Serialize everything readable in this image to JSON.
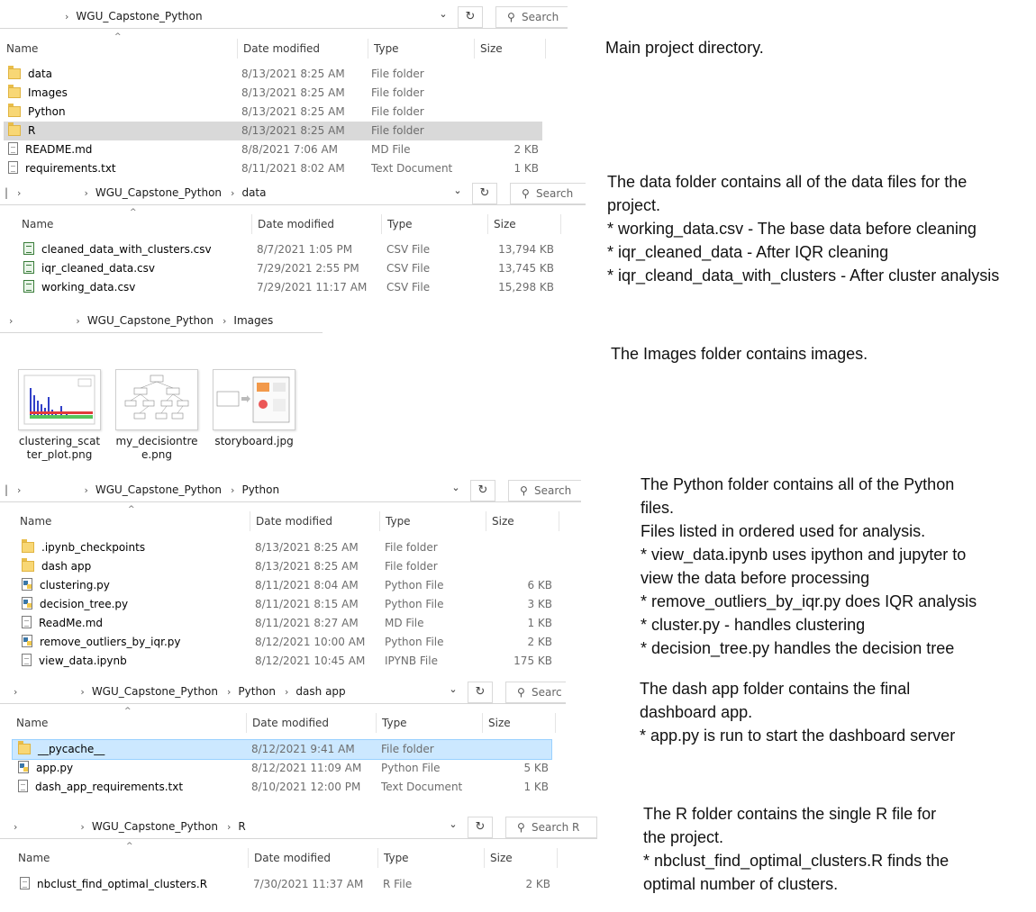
{
  "columns": {
    "name": "Name",
    "date": "Date modified",
    "type": "Type",
    "size": "Size"
  },
  "chevron": "›",
  "sort_caret": "^",
  "dropdown_icon": "chevron-down-icon",
  "refresh_icon": "refresh-icon",
  "search_icon": "search-icon",
  "panels": {
    "root": {
      "crumbs": [
        "WGU_Capstone_Python"
      ],
      "search": "Search",
      "rows": [
        {
          "name": "data",
          "date": "8/13/2021 8:25 AM",
          "type": "File folder",
          "size": ""
        },
        {
          "name": "Images",
          "date": "8/13/2021 8:25 AM",
          "type": "File folder",
          "size": ""
        },
        {
          "name": "Python",
          "date": "8/13/2021 8:25 AM",
          "type": "File folder",
          "size": ""
        },
        {
          "name": "R",
          "date": "8/13/2021 8:25 AM",
          "type": "File folder",
          "size": ""
        },
        {
          "name": "README.md",
          "date": "8/8/2021 7:06 AM",
          "type": "MD File",
          "size": "2 KB"
        },
        {
          "name": "requirements.txt",
          "date": "8/11/2021 8:02 AM",
          "type": "Text Document",
          "size": "1 KB"
        }
      ]
    },
    "data": {
      "crumbs": [
        "WGU_Capstone_Python",
        "data"
      ],
      "search": "Search",
      "rows": [
        {
          "name": "cleaned_data_with_clusters.csv",
          "date": "8/7/2021 1:05 PM",
          "type": "CSV File",
          "size": "13,794 KB"
        },
        {
          "name": "iqr_cleaned_data.csv",
          "date": "7/29/2021 2:55 PM",
          "type": "CSV File",
          "size": "13,745 KB"
        },
        {
          "name": "working_data.csv",
          "date": "7/29/2021 11:17 AM",
          "type": "CSV File",
          "size": "15,298 KB"
        }
      ]
    },
    "images": {
      "crumbs": [
        "WGU_Capstone_Python",
        "Images"
      ],
      "thumbs": [
        {
          "label": "clustering_scatter_plot.png"
        },
        {
          "label": "my_decisiontree.png"
        },
        {
          "label": "storyboard.jpg"
        }
      ]
    },
    "python": {
      "crumbs": [
        "WGU_Capstone_Python",
        "Python"
      ],
      "search": "Search",
      "rows": [
        {
          "name": ".ipynb_checkpoints",
          "date": "8/13/2021 8:25 AM",
          "type": "File folder",
          "size": ""
        },
        {
          "name": "dash app",
          "date": "8/13/2021 8:25 AM",
          "type": "File folder",
          "size": ""
        },
        {
          "name": "clustering.py",
          "date": "8/11/2021 8:04 AM",
          "type": "Python File",
          "size": "6 KB"
        },
        {
          "name": "decision_tree.py",
          "date": "8/11/2021 8:15 AM",
          "type": "Python File",
          "size": "3 KB"
        },
        {
          "name": "ReadMe.md",
          "date": "8/11/2021 8:27 AM",
          "type": "MD File",
          "size": "1 KB"
        },
        {
          "name": "remove_outliers_by_iqr.py",
          "date": "8/12/2021 10:00 AM",
          "type": "Python File",
          "size": "2 KB"
        },
        {
          "name": "view_data.ipynb",
          "date": "8/12/2021 10:45 AM",
          "type": "IPYNB File",
          "size": "175 KB"
        }
      ]
    },
    "dash": {
      "crumbs": [
        "WGU_Capstone_Python",
        "Python",
        "dash app"
      ],
      "search": "Searc",
      "rows": [
        {
          "name": "__pycache__",
          "date": "8/12/2021 9:41 AM",
          "type": "File folder",
          "size": ""
        },
        {
          "name": "app.py",
          "date": "8/12/2021 11:09 AM",
          "type": "Python File",
          "size": "5 KB"
        },
        {
          "name": "dash_app_requirements.txt",
          "date": "8/10/2021 12:00 PM",
          "type": "Text Document",
          "size": "1 KB"
        }
      ]
    },
    "r": {
      "crumbs": [
        "WGU_Capstone_Python",
        "R"
      ],
      "search": "Search R",
      "rows": [
        {
          "name": "nbclust_find_optimal_clusters.R",
          "date": "7/30/2021 11:37 AM",
          "type": "R File",
          "size": "2 KB"
        }
      ]
    }
  },
  "notes": {
    "root": [
      "Main project directory."
    ],
    "data": [
      "The data folder contains all of the data files for the",
      "project.",
      "* working_data.csv - The base data before cleaning",
      "* iqr_cleaned_data - After IQR cleaning",
      "* iqr_cleand_data_with_clusters - After cluster analysis"
    ],
    "images": [
      "The Images folder contains images."
    ],
    "python": [
      "The Python folder contains all of the Python",
      "files.",
      "Files listed in ordered used for analysis.",
      "* view_data.ipynb uses ipython and jupyter to",
      "view the data before processing",
      "* remove_outliers_by_iqr.py does IQR analysis",
      "* cluster.py - handles clustering",
      "* decision_tree.py handles the decision tree"
    ],
    "dash": [
      "The dash app folder contains the final",
      "dashboard app.",
      "* app.py is run to start the dashboard server"
    ],
    "r": [
      "The R folder contains the single R file for",
      "the project.",
      "* nbclust_find_optimal_clusters.R finds the",
      "optimal number of clusters."
    ]
  }
}
